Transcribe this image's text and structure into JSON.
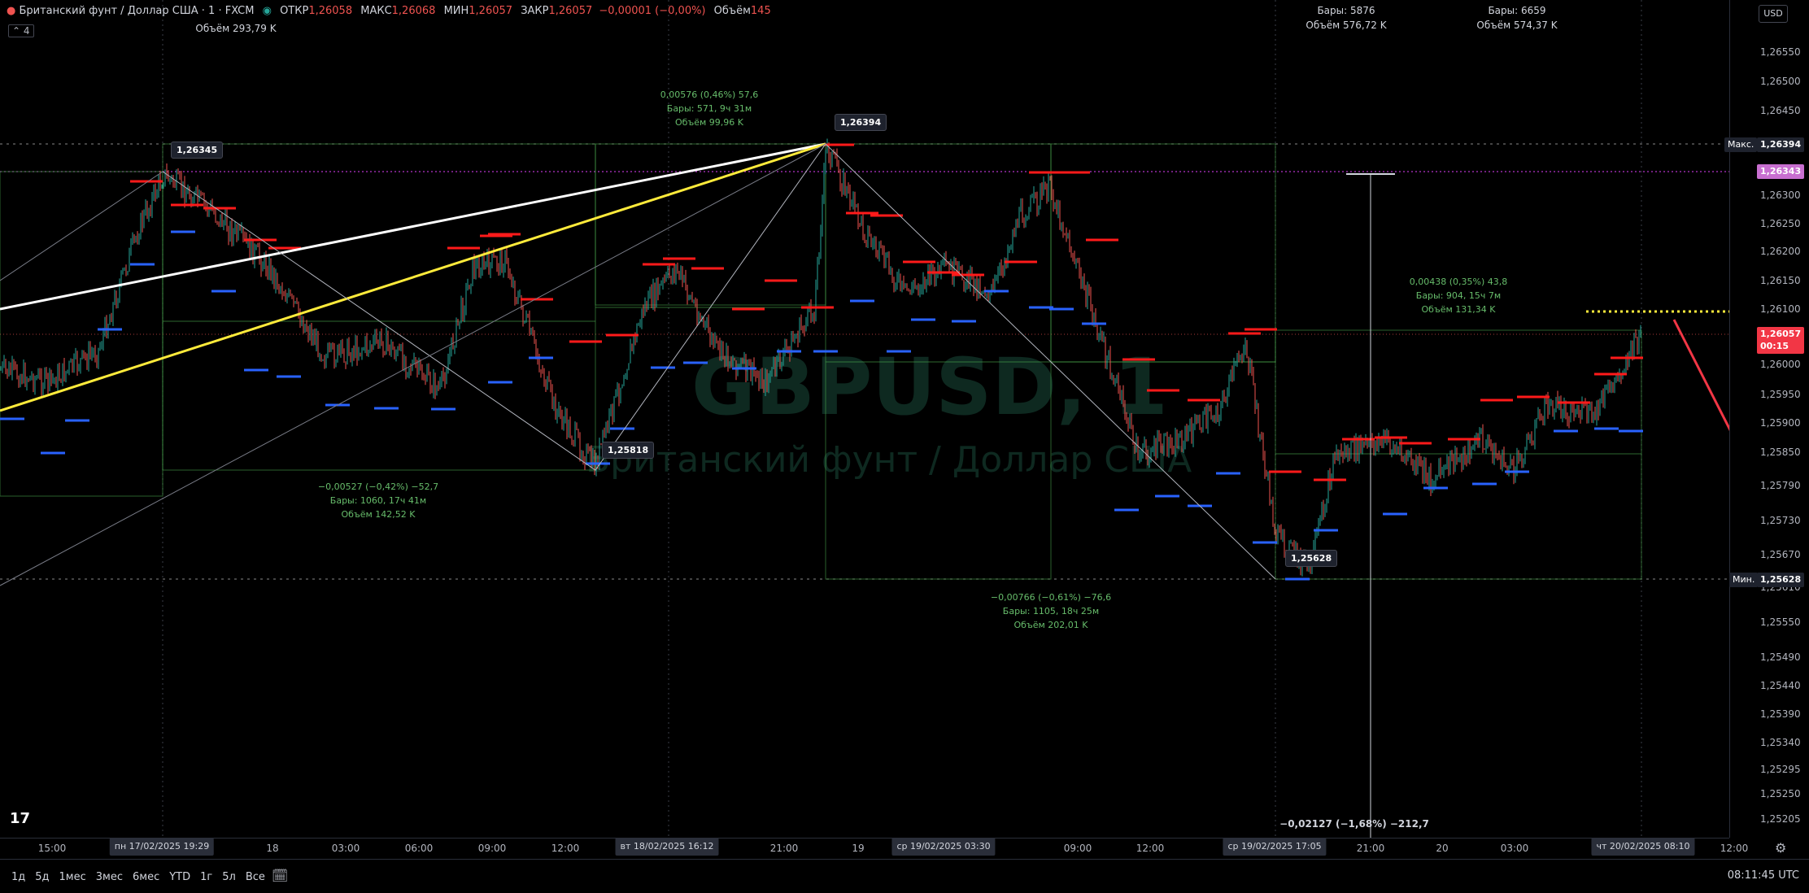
{
  "symbol": {
    "name": "Британский фунт / Доллар США · 1 · FXCM",
    "interval_badge": "4",
    "open_label": "ОТКР",
    "open_value": "1,26058",
    "high_label": "МАКС",
    "high_value": "1,26068",
    "low_label": "МИН",
    "low_value": "1,26057",
    "close_label": "ЗАКР",
    "close_value": "1,26057",
    "change_value": "−0,00001 (−0,00%)",
    "volume_label": "Объём",
    "volume_value": "145"
  },
  "watermark": {
    "ticker": "GBPUSD, 1",
    "description": "Британский фунт / Доллар США"
  },
  "currency_button": "USD",
  "price_axis": {
    "ticks": [
      "1,26550",
      "1,26500",
      "1,26450",
      "1,26394",
      "1,26343",
      "1,26300",
      "1,26250",
      "1,26200",
      "1,26150",
      "1,26100",
      "1,26057",
      "1,26000",
      "1,25950",
      "1,25900",
      "1,25850",
      "1,25790",
      "1,25730",
      "1,25670",
      "1,25628",
      "1,25610",
      "1,25550",
      "1,25490",
      "1,25440",
      "1,25390",
      "1,25340",
      "1,25295",
      "1,25250",
      "1,25205"
    ],
    "max_label": "Макс.",
    "max_value": "1,26394",
    "pink_value": "1,26343",
    "current_value": "1,26057",
    "countdown": "00:15",
    "min_label": "Мин.",
    "min_value": "1,25628"
  },
  "time_axis": {
    "labels": [
      "15:00",
      "18",
      "03:00",
      "06:00",
      "09:00",
      "12:00",
      "21:00",
      "19",
      "09:00",
      "12:00",
      "21:00",
      "20",
      "03:00",
      "12:00"
    ],
    "badges": [
      "пн 17/02/2025   19:29",
      "вт 18/02/2025   16:12",
      "ср 19/02/2025   03:30",
      "ср 19/02/2025   17:05",
      "чт 20/02/2025   08:10"
    ]
  },
  "callouts": {
    "p1": "1,26345",
    "p2": "1,26394",
    "p3": "1,25818",
    "p4": "1,25628"
  },
  "notes": {
    "top_left_volume": "Объём 293,79 K",
    "range_a": {
      "line1": "0,00576 (0,46%) 57,6",
      "line2": "Бары: 571, 9ч 31м",
      "line3": "Объём 99,96 K"
    },
    "range_b": {
      "line1": "−0,00527 (−0,42%) −52,7",
      "line2": "Бары: 1060, 17ч 41м",
      "line3": "Объём 142,52 K"
    },
    "range_c": {
      "line1": "−0,00766 (−0,61%) −76,6",
      "line2": "Бары: 1105, 18ч 25м",
      "line3": "Объём 202,01 K"
    },
    "range_d": {
      "line1": "0,00438 (0,35%) 43,8",
      "line2": "Бары: 904, 15ч 7м",
      "line3": "Объём 131,34 K"
    },
    "bars_a": {
      "line1": "Бары: 5876",
      "line2": "Объём 576,72 K"
    },
    "bars_b": {
      "line1": "Бары: 6659",
      "line2": "Объём 574,37 K"
    },
    "long_range": "−0,02127 (−1,68%) −212,7"
  },
  "timeframes": [
    "1д",
    "5д",
    "1мес",
    "3мес",
    "6мес",
    "YTD",
    "1г",
    "5л",
    "Все"
  ],
  "clock": "08:11:45 UTC",
  "colors": {
    "up": "#26a69a",
    "down": "#ef5350",
    "red_level": "#ff1a1a",
    "blue_level": "#2962ff",
    "yellow": "#ffeb3b",
    "pink": "#e040fb",
    "green_box": "#4caf50"
  }
}
